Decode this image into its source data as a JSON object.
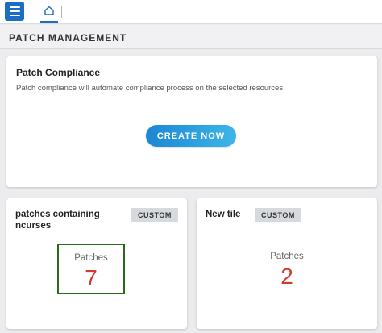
{
  "topbar": {
    "menu_icon": "hamburger-icon",
    "home_icon": "home-icon"
  },
  "page": {
    "title": "PATCH MANAGEMENT"
  },
  "compliance": {
    "title": "Patch Compliance",
    "description": "Patch compliance will automate compliance process on the selected resources",
    "button_label": "CREATE NOW"
  },
  "tiles": [
    {
      "title": "patches containing ncurses",
      "badge": "CUSTOM",
      "label": "Patches",
      "value": "7"
    },
    {
      "title": "New tile",
      "badge": "CUSTOM",
      "label": "Patches",
      "value": "2"
    }
  ],
  "colors": {
    "accent": "#1b6ec2",
    "value_red": "#d33a2f",
    "highlight_border": "#2a6a17"
  }
}
